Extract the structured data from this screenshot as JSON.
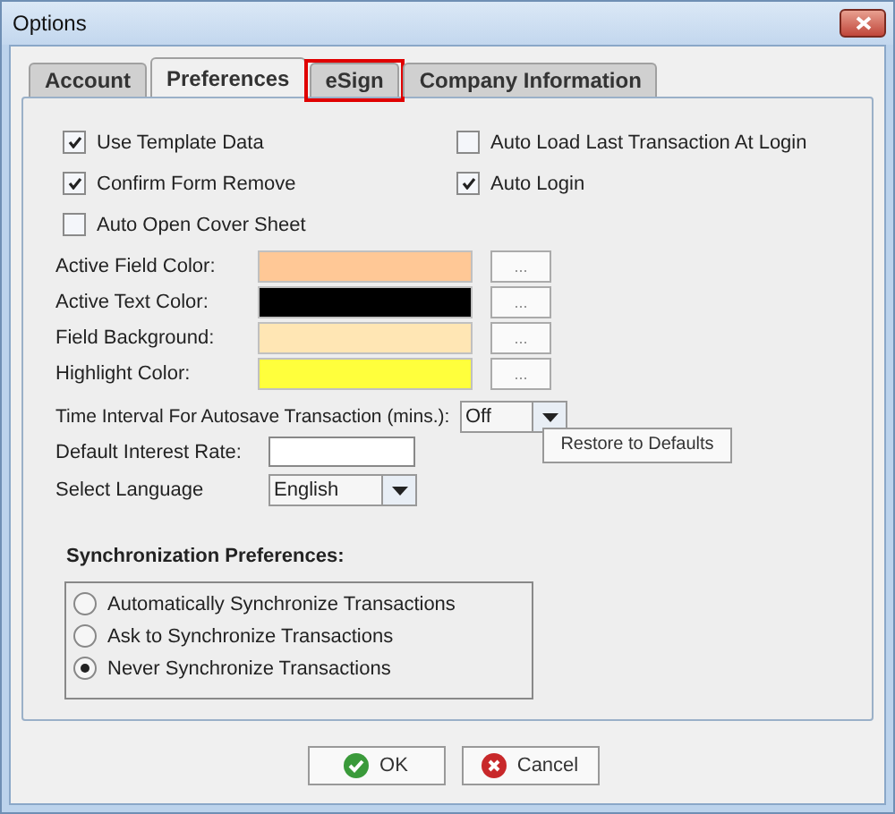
{
  "window": {
    "title": "Options"
  },
  "tabs": [
    {
      "label": "Account",
      "selected": false,
      "highlighted": false
    },
    {
      "label": "Preferences",
      "selected": true,
      "highlighted": false
    },
    {
      "label": "eSign",
      "selected": false,
      "highlighted": true
    },
    {
      "label": "Company Information",
      "selected": false,
      "highlighted": false
    }
  ],
  "checkboxes": [
    {
      "label": "Use Template Data",
      "checked": true
    },
    {
      "label": "Auto Load Last Transaction At Login",
      "checked": false
    },
    {
      "label": "Confirm Form Remove",
      "checked": true
    },
    {
      "label": "Auto Login",
      "checked": true
    },
    {
      "label": "Auto Open Cover Sheet",
      "checked": false
    }
  ],
  "colors": [
    {
      "label": "Active Field Color:",
      "color": "#ffc896",
      "button": "..."
    },
    {
      "label": "Active Text Color:",
      "color": "#000000",
      "button": "..."
    },
    {
      "label": "Field Background:",
      "color": "#ffe6b4",
      "button": "..."
    },
    {
      "label": "Highlight Color:",
      "color": "#ffff3c",
      "button": "..."
    }
  ],
  "autosave": {
    "label": "Time Interval For Autosave Transaction (mins.):",
    "value": "Off"
  },
  "interest": {
    "label": "Default Interest Rate:"
  },
  "restore_button": "Restore to Defaults",
  "language": {
    "label": "Select Language",
    "value": "English"
  },
  "sync": {
    "title": "Synchronization Preferences:",
    "options": [
      {
        "label": "Automatically Synchronize Transactions",
        "selected": false
      },
      {
        "label": "Ask to Synchronize Transactions",
        "selected": false
      },
      {
        "label": "Never Synchronize Transactions",
        "selected": true
      }
    ]
  },
  "buttons": [
    {
      "kind": "ok",
      "label": "OK"
    },
    {
      "kind": "cancel",
      "label": "Cancel"
    }
  ]
}
